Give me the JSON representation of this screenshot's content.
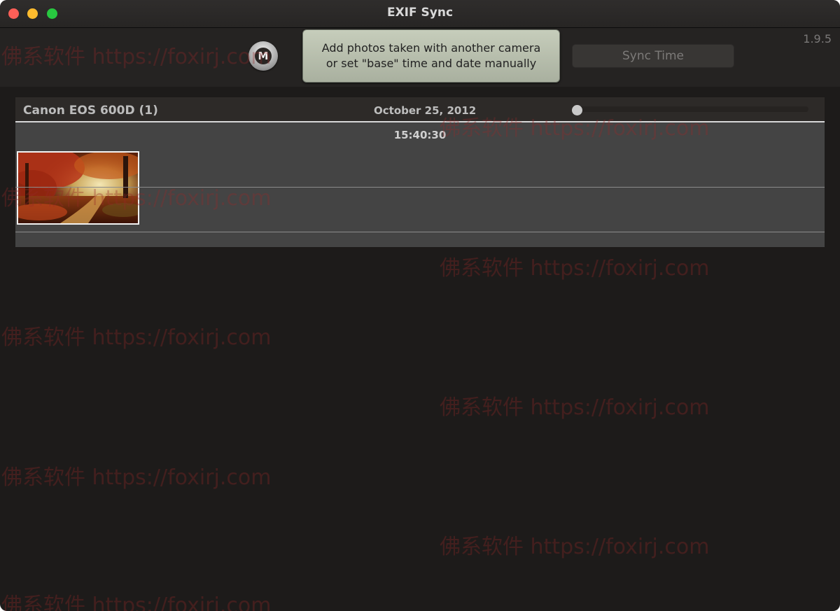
{
  "window": {
    "title": "EXIF Sync"
  },
  "toolbar": {
    "manual_button_label": "M",
    "add_photos_line1": "Add photos taken with another camera",
    "add_photos_line2": "or set \"base\" time and date manually",
    "sync_button_label": "Sync Time",
    "version": "1.9.5"
  },
  "camera": {
    "name": "Canon EOS 600D (1)",
    "date": "October 25, 2012",
    "slider_value": 0,
    "time": "15:40:30",
    "photos": [
      {
        "thumbnail": "autumn-forest-path"
      }
    ]
  },
  "watermark": {
    "text": "佛系软件 https://foxirj.com"
  },
  "colors": {
    "background": "#1d1b1a",
    "panel": "#444444",
    "add_button": "#b9c0ad",
    "close": "#fe5f57",
    "minimize": "#febc2e",
    "zoom": "#28c840"
  }
}
